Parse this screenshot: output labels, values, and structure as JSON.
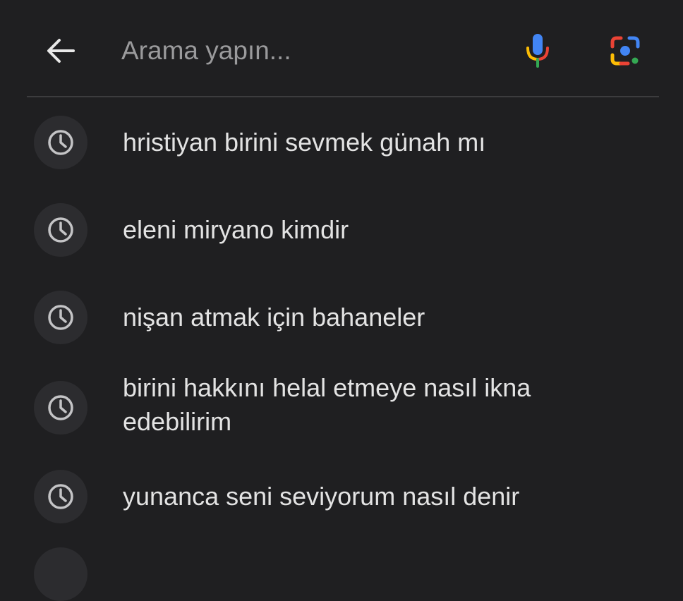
{
  "search": {
    "placeholder": "Arama yapın..."
  },
  "icons": {
    "back": "arrow-left-icon",
    "mic": "microphone-icon",
    "lens": "google-lens-icon",
    "history": "history-clock-icon"
  },
  "colors": {
    "background": "#1f1f21",
    "text": "#e3e3e3",
    "placeholder": "#9a9a9c",
    "badge": "#2c2c2f",
    "google_blue": "#4285f4",
    "google_red": "#ea4335",
    "google_yellow": "#fbbc05",
    "google_green": "#34a853"
  },
  "suggestions": [
    {
      "text": "hristiyan birini sevmek günah mı"
    },
    {
      "text": "eleni miryano kimdir"
    },
    {
      "text": "nişan atmak için bahaneler"
    },
    {
      "text": "birini hakkını helal etmeye nasıl ikna edebilirim"
    },
    {
      "text": "yunanca seni seviyorum nasıl denir"
    }
  ]
}
